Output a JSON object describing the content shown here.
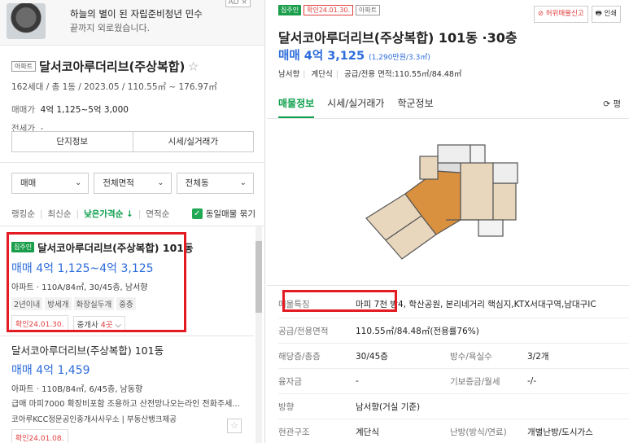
{
  "ad": {
    "line1": "하늘의 별이 된 자립준비청년 민수",
    "line2": "끝까지 외로웠습니다.",
    "badge": "AD ×"
  },
  "complex": {
    "tag": "아파트",
    "name": "달서코아루더리브(주상복합)",
    "star": "☆",
    "meta": "162세대 / 총 1동 / 2023.05 / 110.55㎡ ~ 176.97㎡",
    "price_label": "매매가",
    "price_value": "4억 1,125~5억 3,000",
    "jeonse_label": "전세가",
    "jeonse_value": "-",
    "btn_info": "단지정보",
    "btn_market": "시세/실거래가"
  },
  "filters": {
    "trade": "매매",
    "area": "전체면적",
    "dong": "전체동"
  },
  "sort": {
    "ranking": "랭킹순",
    "latest": "최신순",
    "low_price": "낮은가격순 ↓",
    "area": "면적순",
    "same_listing": "동일매물 묶기"
  },
  "listing1": {
    "badge": "집주인",
    "title": "달서코아루더리브(주상복합) 101동",
    "price": "매매 4억 1,125~4억 3,125",
    "desc": "아파트 · 110A/84㎡, 30/45층, 남서향",
    "chips": [
      "2년이내",
      "방세개",
      "화장실두개",
      "중층"
    ],
    "confirm": "확인24.01.30.",
    "agents_prefix": "중개사 ",
    "agents_count": "4곳",
    "agents_chev": "⌵"
  },
  "listing2": {
    "title": "달서코아루더리브(주상복합) 101동",
    "price": "매매 4억 1,459",
    "desc": "아파트 · 110B/84㎡, 6/45층, 남동향",
    "desc2": "급매 마피7000 확장비포함 조용하고 산전망나오는라인 전화주세...",
    "agency": "코아루KCC정문공인중개사사무소 | 부동산뱅크제공",
    "confirm": "확인24.01.08.",
    "star": "☆"
  },
  "right": {
    "badge_owner": "집주인",
    "badge_confirm": "확인24.01.30.",
    "badge_type": "아파트",
    "tool_report": "⊘ 허위매물신고",
    "tool_print": "🖶 인쇄",
    "title": "달서코아루더리브(주상복합) 101동 ·30층",
    "price": "매매 4억 3,125",
    "price_sub": "(1,290만원/3.3㎡)",
    "sub": [
      "남서향",
      "계단식",
      "공급/전용 면적:110.55㎡/84.48㎡"
    ],
    "tabs": [
      "매물정보",
      "시세/실거래가",
      "학군정보"
    ],
    "refresh": "⟳ 평"
  },
  "details": [
    {
      "k": "매물특징",
      "v": "마피 7천 방4, 학산공원, 본리네거리 핵심지,KTX서대구역,남대구IC",
      "wide": true
    },
    {
      "k": "공급/전용면적",
      "v": "110.55㎡/84.48㎡(전용률76%)",
      "wide": true
    },
    {
      "k": "해당층/총층",
      "v": "30/45층",
      "k2": "방수/욕실수",
      "v2": "3/2개"
    },
    {
      "k": "융자금",
      "v": "-",
      "k2": "기보증금/월세",
      "v2": "-/-"
    },
    {
      "k": "방향",
      "v": "남서향(거실 기준)",
      "wide": true
    },
    {
      "k": "현관구조",
      "v": "계단식",
      "k2": "난방(방식/연료)",
      "v2": "개별난방/도시가스"
    }
  ],
  "colors": {
    "green": "#0b9e4a",
    "blue": "#2c6cdb",
    "red": "#e51b23"
  }
}
